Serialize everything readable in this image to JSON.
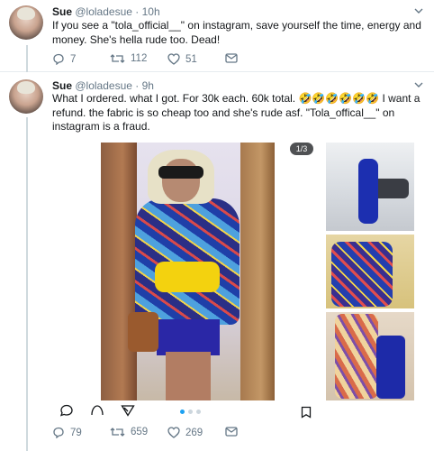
{
  "tweets": [
    {
      "name": "Sue",
      "handle": "@loladesue",
      "separator": "·",
      "time": "10h",
      "text": "If you see a \"tola_official__\" on instagram, save yourself the time, energy and money. She's hella rude too. Dead!",
      "replies": "7",
      "retweets": "112",
      "likes": "51"
    },
    {
      "name": "Sue",
      "handle": "@loladesue",
      "separator": "·",
      "time": "9h",
      "text": "What I ordered. what I got. For 30k each. 60k total. 🤣🤣🤣🤣🤣🤣 I want a refund. the fabric is so cheap too and she's rude asf. \"Tola_offical__\" on instagram is a fraud.",
      "media_counter": "1/3",
      "replies": "79",
      "retweets": "659",
      "likes": "269"
    }
  ],
  "icons": {
    "reply": "reply-icon",
    "retweet": "retweet-icon",
    "like": "heart-icon",
    "dm": "envelope-icon",
    "caret": "chevron-down-icon",
    "bookmark": "bookmark-icon"
  },
  "colors": {
    "text": "#14171a",
    "secondary": "#657786",
    "divider": "#e6ecf0",
    "accent": "#1da1f2"
  }
}
